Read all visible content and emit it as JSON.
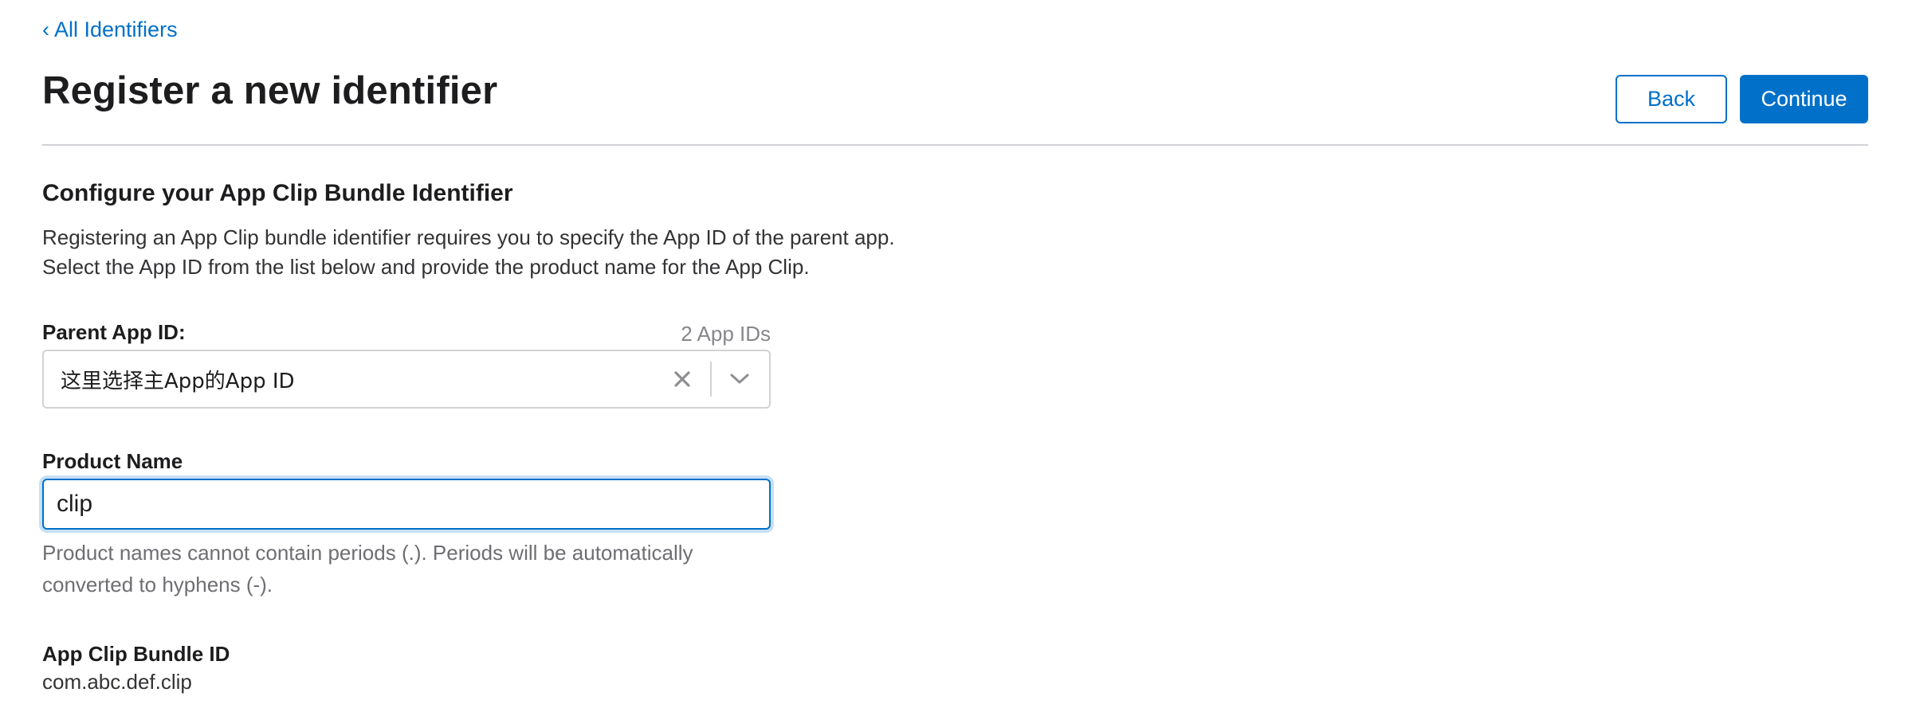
{
  "breadcrumb": {
    "label": "All Identifiers",
    "chevron": "‹"
  },
  "header": {
    "title": "Register a new identifier"
  },
  "actions": {
    "back_label": "Back",
    "continue_label": "Continue"
  },
  "section": {
    "title": "Configure your App Clip Bundle Identifier",
    "description_line1": "Registering an App Clip bundle identifier requires you to specify the App ID of the parent app.",
    "description_line2": "Select the App ID from the list below and provide the product name for the App Clip."
  },
  "parent_app": {
    "label": "Parent App ID:",
    "count": "2 App IDs",
    "selected_value": "这里选择主App的App ID"
  },
  "product_name": {
    "label": "Product Name",
    "value": "clip",
    "helper_line1": "Product names cannot contain periods (.). Periods will be automatically",
    "helper_line2": "converted to hyphens (-)."
  },
  "bundle": {
    "label": "App Clip Bundle ID",
    "value": "com.abc.def.clip"
  },
  "colors": {
    "accent": "#0070c9",
    "border": "#d2d2d7",
    "muted": "#86868b"
  }
}
